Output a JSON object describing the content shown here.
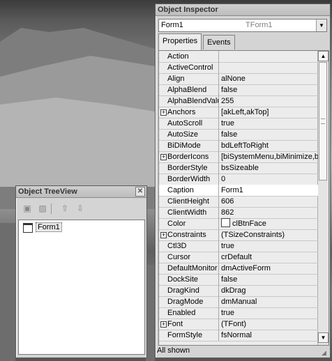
{
  "inspector": {
    "title": "Object Inspector",
    "object_selector": {
      "name": "Form1",
      "class": "TForm1"
    },
    "tabs": [
      {
        "label": "Properties",
        "active": true
      },
      {
        "label": "Events",
        "active": false
      }
    ],
    "properties": [
      {
        "name": "Action",
        "value": "",
        "expandable": false
      },
      {
        "name": "ActiveControl",
        "value": "",
        "expandable": false
      },
      {
        "name": "Align",
        "value": "alNone",
        "expandable": false
      },
      {
        "name": "AlphaBlend",
        "value": "false",
        "expandable": false
      },
      {
        "name": "AlphaBlendValu",
        "value": "255",
        "expandable": false
      },
      {
        "name": "Anchors",
        "value": "[akLeft,akTop]",
        "expandable": true
      },
      {
        "name": "AutoScroll",
        "value": "true",
        "expandable": false
      },
      {
        "name": "AutoSize",
        "value": "false",
        "expandable": false
      },
      {
        "name": "BiDiMode",
        "value": "bdLeftToRight",
        "expandable": false
      },
      {
        "name": "BorderIcons",
        "value": "[biSystemMenu,biMinimize,biM",
        "expandable": true
      },
      {
        "name": "BorderStyle",
        "value": "bsSizeable",
        "expandable": false
      },
      {
        "name": "BorderWidth",
        "value": "0",
        "expandable": false
      },
      {
        "name": "Caption",
        "value": "Form1",
        "expandable": false,
        "selected": true
      },
      {
        "name": "ClientHeight",
        "value": "606",
        "expandable": false
      },
      {
        "name": "ClientWidth",
        "value": "862",
        "expandable": false
      },
      {
        "name": "Color",
        "value": "clBtnFace",
        "expandable": false,
        "swatch": "#ffffff"
      },
      {
        "name": "Constraints",
        "value": "(TSizeConstraints)",
        "expandable": true
      },
      {
        "name": "Ctl3D",
        "value": "true",
        "expandable": false
      },
      {
        "name": "Cursor",
        "value": "crDefault",
        "expandable": false
      },
      {
        "name": "DefaultMonitor",
        "value": "dmActiveForm",
        "expandable": false
      },
      {
        "name": "DockSite",
        "value": "false",
        "expandable": false
      },
      {
        "name": "DragKind",
        "value": "dkDrag",
        "expandable": false
      },
      {
        "name": "DragMode",
        "value": "dmManual",
        "expandable": false
      },
      {
        "name": "Enabled",
        "value": "true",
        "expandable": false
      },
      {
        "name": "Font",
        "value": "(TFont)",
        "expandable": true
      },
      {
        "name": "FormStyle",
        "value": "fsNormal",
        "expandable": false
      }
    ],
    "status": "All shown",
    "icons": {
      "dropdown": "chevron-down-icon",
      "close": "close-icon",
      "expand": "plus-icon"
    }
  },
  "treeview": {
    "title": "Object TreeView",
    "toolbar": [
      {
        "icon": "new-item-icon"
      },
      {
        "icon": "delete-item-icon"
      },
      {
        "icon": "move-up-icon"
      },
      {
        "icon": "move-down-icon"
      }
    ],
    "nodes": [
      {
        "label": "Form1"
      }
    ]
  }
}
